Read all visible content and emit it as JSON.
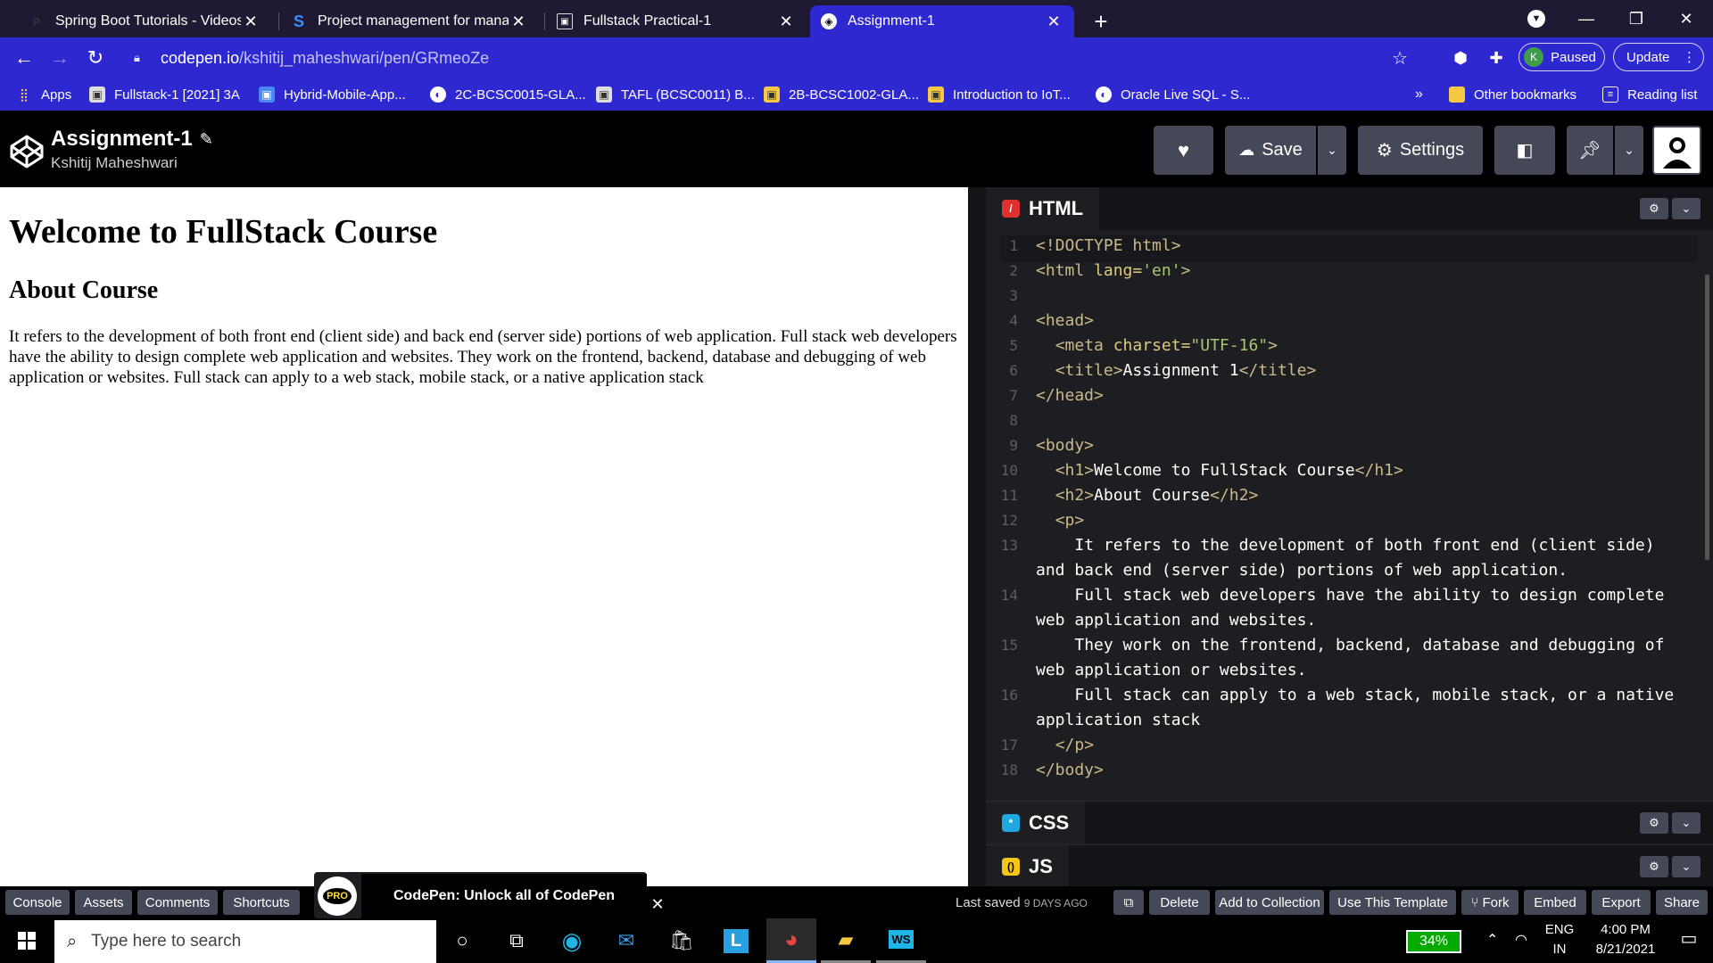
{
  "browser": {
    "tabs": [
      {
        "title": "Spring Boot Tutorials - Videos, C",
        "favicon": "p-icon",
        "active": false
      },
      {
        "title": "Project management for manage",
        "favicon": "s-icon",
        "active": false
      },
      {
        "title": "Fullstack Practical-1",
        "favicon": "classroom-icon",
        "active": false
      },
      {
        "title": "Assignment-1",
        "favicon": "codepen-icon",
        "active": true
      }
    ],
    "new_tab_label": "+",
    "url_host": "codepen.io",
    "url_path": "/kshitij_maheshwari/pen/GRmeoZe",
    "profile_initial": "K",
    "profile_label": "Paused",
    "update_label": "Update",
    "accent_color": "#2d28d0",
    "bookmarks": [
      {
        "label": "Apps",
        "icon": "apps-grid-icon"
      },
      {
        "label": "Fullstack-1 [2021] 3A",
        "icon": "classroom-icon"
      },
      {
        "label": "Hybrid-Mobile-App...",
        "icon": "classroom-icon"
      },
      {
        "label": "2C-BCSC0015-GLA...",
        "icon": "globe-icon"
      },
      {
        "label": "TAFL (BCSC0011) B...",
        "icon": "classroom-icon"
      },
      {
        "label": "2B-BCSC1002-GLA...",
        "icon": "classroom-icon"
      },
      {
        "label": "Introduction to IoT...",
        "icon": "classroom-icon"
      },
      {
        "label": "Oracle Live SQL - S...",
        "icon": "globe-icon"
      }
    ],
    "more_bookmarks": "»",
    "other_bookmarks": "Other bookmarks",
    "reading_list": "Reading list"
  },
  "codepen": {
    "pen_title": "Assignment-1",
    "author": "Kshitij Maheshwari",
    "save_label": "Save",
    "settings_label": "Settings"
  },
  "preview": {
    "h1": "Welcome to FullStack Course",
    "h2": "About Course",
    "paragraph": "It refers to the development of both front end (client side) and back end (server side) portions of web application. Full stack web developers have the ability to design complete web application and websites. They work on the frontend, backend, database and debugging of web application or websites. Full stack can apply to a web stack, mobile stack, or a native application stack"
  },
  "editor": {
    "html_label": "HTML",
    "css_label": "CSS",
    "js_label": "JS",
    "lines": [
      {
        "n": "1",
        "segs": [
          [
            "tg",
            "<!DOCTYPE html>"
          ]
        ]
      },
      {
        "n": "2",
        "segs": [
          [
            "tg",
            "<html "
          ],
          [
            "at",
            "lang="
          ],
          [
            "st",
            "'en'"
          ],
          [
            "tg",
            ">"
          ]
        ]
      },
      {
        "n": "3",
        "segs": []
      },
      {
        "n": "4",
        "segs": [
          [
            "tg",
            "<head>"
          ]
        ]
      },
      {
        "n": "5",
        "segs": [
          [
            "tg",
            "  <meta "
          ],
          [
            "at",
            "charset="
          ],
          [
            "st",
            "\"UTF-16\""
          ],
          [
            "tg",
            ">"
          ]
        ]
      },
      {
        "n": "6",
        "segs": [
          [
            "tg",
            "  <title>"
          ],
          [
            "tx",
            "Assignment 1"
          ],
          [
            "tg",
            "</title>"
          ]
        ]
      },
      {
        "n": "7",
        "segs": [
          [
            "tg",
            "</head>"
          ]
        ]
      },
      {
        "n": "8",
        "segs": []
      },
      {
        "n": "9",
        "segs": [
          [
            "tg",
            "<body>"
          ]
        ]
      },
      {
        "n": "10",
        "segs": [
          [
            "tg",
            "  <h1>"
          ],
          [
            "tx",
            "Welcome to FullStack Course"
          ],
          [
            "tg",
            "</h1>"
          ]
        ]
      },
      {
        "n": "11",
        "segs": [
          [
            "tg",
            "  <h2>"
          ],
          [
            "tx",
            "About Course"
          ],
          [
            "tg",
            "</h2>"
          ]
        ]
      },
      {
        "n": "12",
        "segs": [
          [
            "tg",
            "  <p>"
          ]
        ]
      },
      {
        "n": "13",
        "segs": [
          [
            "tx",
            "    It refers to the development of both front end (client side) and back end (server side) portions of web application."
          ]
        ]
      },
      {
        "n": "14",
        "segs": [
          [
            "tx",
            "    Full stack web developers have the ability to design complete web application and websites."
          ]
        ]
      },
      {
        "n": "15",
        "segs": [
          [
            "tx",
            "    They work on the frontend, backend, database and debugging of web application or websites."
          ]
        ]
      },
      {
        "n": "16",
        "segs": [
          [
            "tx",
            "    Full stack can apply to a web stack, mobile stack, or a native application stack"
          ]
        ]
      },
      {
        "n": "17",
        "segs": [
          [
            "tg",
            "  </p>"
          ]
        ]
      },
      {
        "n": "18",
        "segs": [
          [
            "tg",
            "</body>"
          ]
        ]
      }
    ]
  },
  "footer": {
    "buttons": [
      "Console",
      "Assets",
      "Comments",
      "Shortcuts"
    ],
    "promo_badge": "PRO",
    "promo_text": "CodePen: Unlock all of CodePen",
    "last_saved": "Last saved",
    "last_saved_ago": "9 DAYS AGO",
    "actions": [
      "Delete",
      "Add to Collection",
      "Use This Template",
      "Fork",
      "Embed",
      "Export",
      "Share"
    ]
  },
  "taskbar": {
    "search_placeholder": "Type here to search",
    "battery": "34%",
    "lang_top": "ENG",
    "lang_bottom": "IN",
    "time": "4:00 PM",
    "date": "8/21/2021"
  }
}
